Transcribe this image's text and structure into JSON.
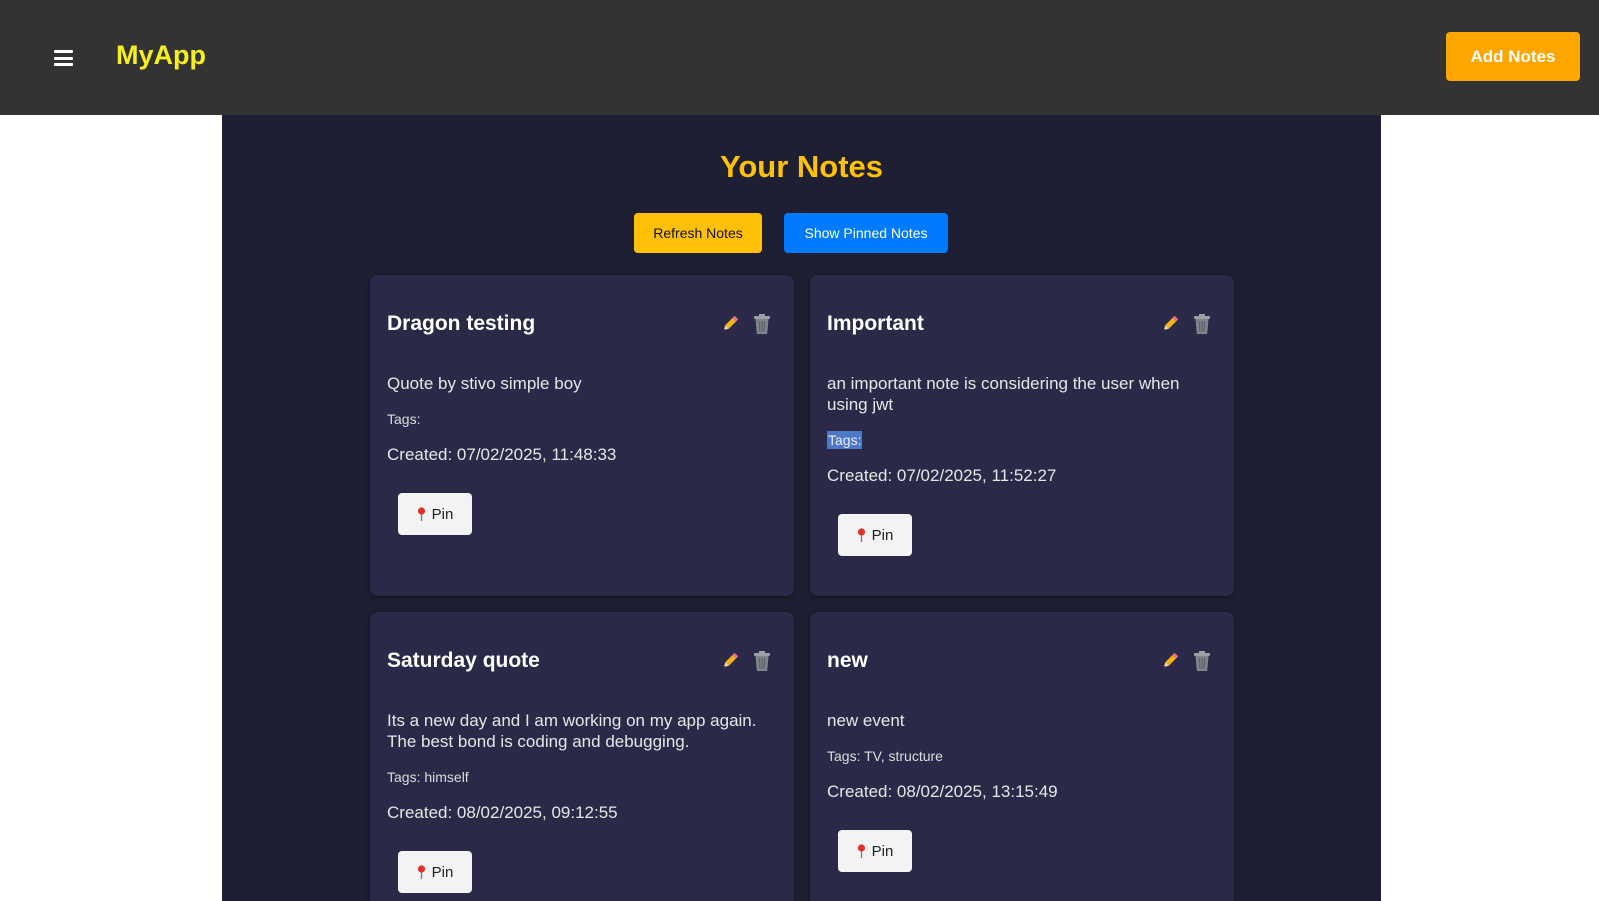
{
  "header": {
    "brand": "MyApp",
    "add_notes_label": "Add Notes",
    "menu_icon": "hamburger-menu-icon"
  },
  "main": {
    "title": "Your Notes",
    "refresh_label": "Refresh Notes",
    "show_pinned_label": "Show Pinned Notes"
  },
  "notes": [
    {
      "title": "Dragon testing",
      "content": "Quote by stivo simple boy",
      "tags": "Tags:",
      "created": "Created: 07/02/2025, 11:48:33",
      "pin_label": "Pin"
    },
    {
      "title": "Important",
      "content": "an important note is considering the user when using jwt",
      "tags": "Tags:",
      "created": "Created: 07/02/2025, 11:52:27",
      "pin_label": "Pin"
    },
    {
      "title": "Saturday quote",
      "content": "Its a new day and I am working on my app again. The best bond is coding and debugging.",
      "tags": "Tags: himself",
      "created": "Created: 08/02/2025, 09:12:55",
      "pin_label": "Pin"
    },
    {
      "title": "new",
      "content": "new event",
      "tags": "Tags: TV, structure",
      "created": "Created: 08/02/2025, 13:15:49",
      "pin_label": "Pin"
    }
  ],
  "icons": {
    "edit": "pencil-icon",
    "delete": "trash-icon",
    "pin": "pushpin-icon"
  },
  "colors": {
    "navbar": "#333333",
    "brand": "#f5ef1f",
    "accent_orange": "#ffa500",
    "title_yellow": "#ffc107",
    "primary_blue": "#007bff",
    "panel": "#1f1f33",
    "card": "#2a2a48"
  }
}
